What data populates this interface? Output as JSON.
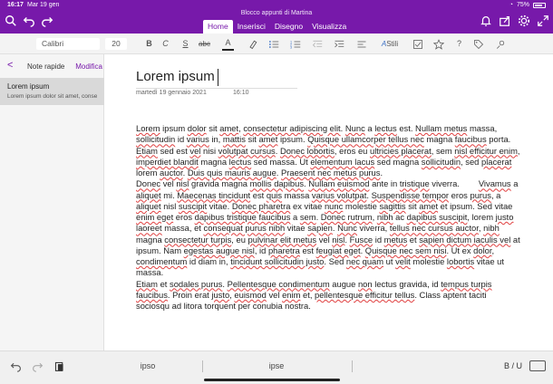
{
  "status": {
    "time": "16:17",
    "date": "Mar 19 gen",
    "battery": "75%"
  },
  "window_title": "Blocco appunti di Martina",
  "tabs": [
    {
      "label": "Home"
    },
    {
      "label": "Inserisci"
    },
    {
      "label": "Disegno"
    },
    {
      "label": "Visualizza"
    }
  ],
  "toolbar": {
    "font_name": "Calibri",
    "font_size": "20",
    "bold": "B",
    "italic": "C",
    "underline": "S",
    "strikethrough": "abc",
    "font_color": "A",
    "styles_label": "Stili"
  },
  "left_pane": {
    "back": "<",
    "title": "Note rapide",
    "edit": "Modifica",
    "page_item": {
      "title": "Lorem ipsum",
      "snippet": "Lorem ipsum dolor sit amet, consectetur a"
    }
  },
  "page": {
    "title": "Lorem ipsum",
    "date": "martedì 19 gennaio 2021",
    "time": "16:10"
  },
  "bottom": {
    "suggestions": [
      "ipso",
      "ipse"
    ],
    "biu": "B / U"
  },
  "colors": {
    "accent": "#7719aa",
    "squiggle": "#e04040"
  }
}
